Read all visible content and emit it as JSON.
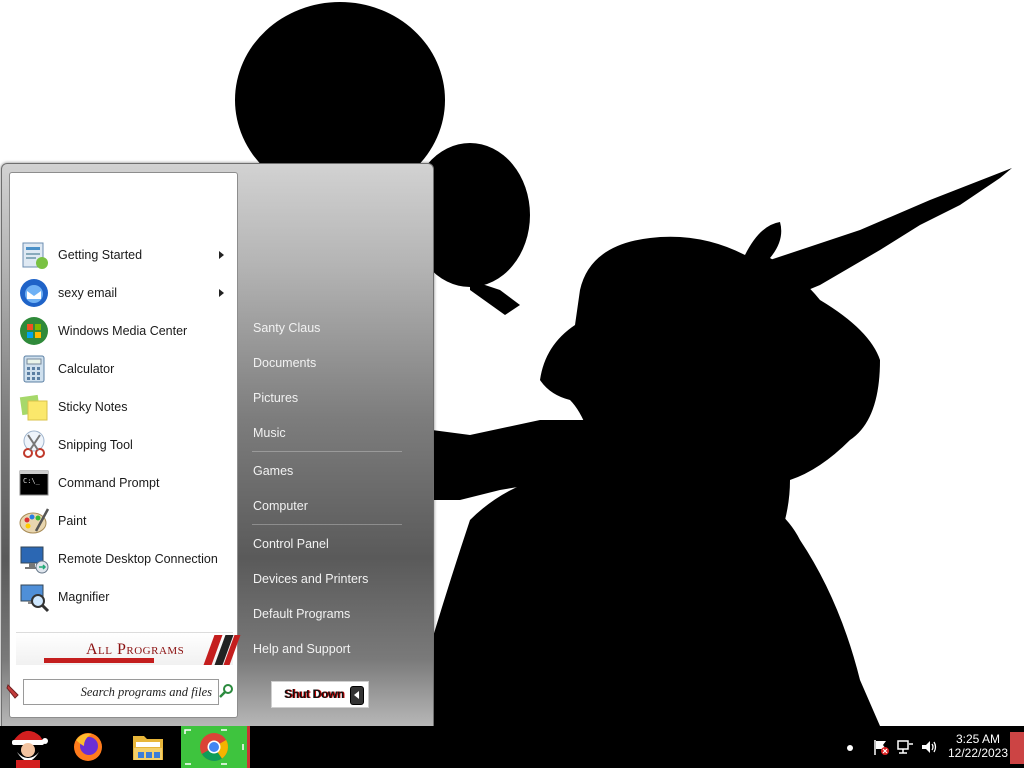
{
  "start_menu": {
    "programs": [
      {
        "label": "Getting Started",
        "icon": "getting-started-icon",
        "has_submenu": true
      },
      {
        "label": "sexy email",
        "icon": "thunderbird-icon",
        "has_submenu": true
      },
      {
        "label": "Windows Media Center",
        "icon": "media-center-icon",
        "has_submenu": false
      },
      {
        "label": "Calculator",
        "icon": "calculator-icon",
        "has_submenu": false
      },
      {
        "label": "Sticky Notes",
        "icon": "sticky-notes-icon",
        "has_submenu": false
      },
      {
        "label": "Snipping Tool",
        "icon": "snipping-tool-icon",
        "has_submenu": false
      },
      {
        "label": "Command Prompt",
        "icon": "command-prompt-icon",
        "has_submenu": false
      },
      {
        "label": "Paint",
        "icon": "paint-icon",
        "has_submenu": false
      },
      {
        "label": "Remote Desktop Connection",
        "icon": "remote-desktop-icon",
        "has_submenu": false
      },
      {
        "label": "Magnifier",
        "icon": "magnifier-icon",
        "has_submenu": false
      }
    ],
    "all_programs_label": "All Programs",
    "search_placeholder": "Search programs and files",
    "right_items": [
      "Santy Claus",
      "Documents",
      "Pictures",
      "Music",
      "Games",
      "Computer",
      "Control Panel",
      "Devices and Printers",
      "Default Programs",
      "Help and Support"
    ],
    "shutdown_label": "Shut Down"
  },
  "taskbar": {
    "buttons": [
      "santa-start-icon",
      "firefox-icon",
      "file-explorer-icon",
      "chrome-icon"
    ],
    "clock_time": "3:25 AM",
    "clock_date": "12/22/2023"
  },
  "colors": {
    "taskbar": "#000000",
    "chrome_highlight": "#3ec43e",
    "all_programs_text": "#8b1010"
  }
}
